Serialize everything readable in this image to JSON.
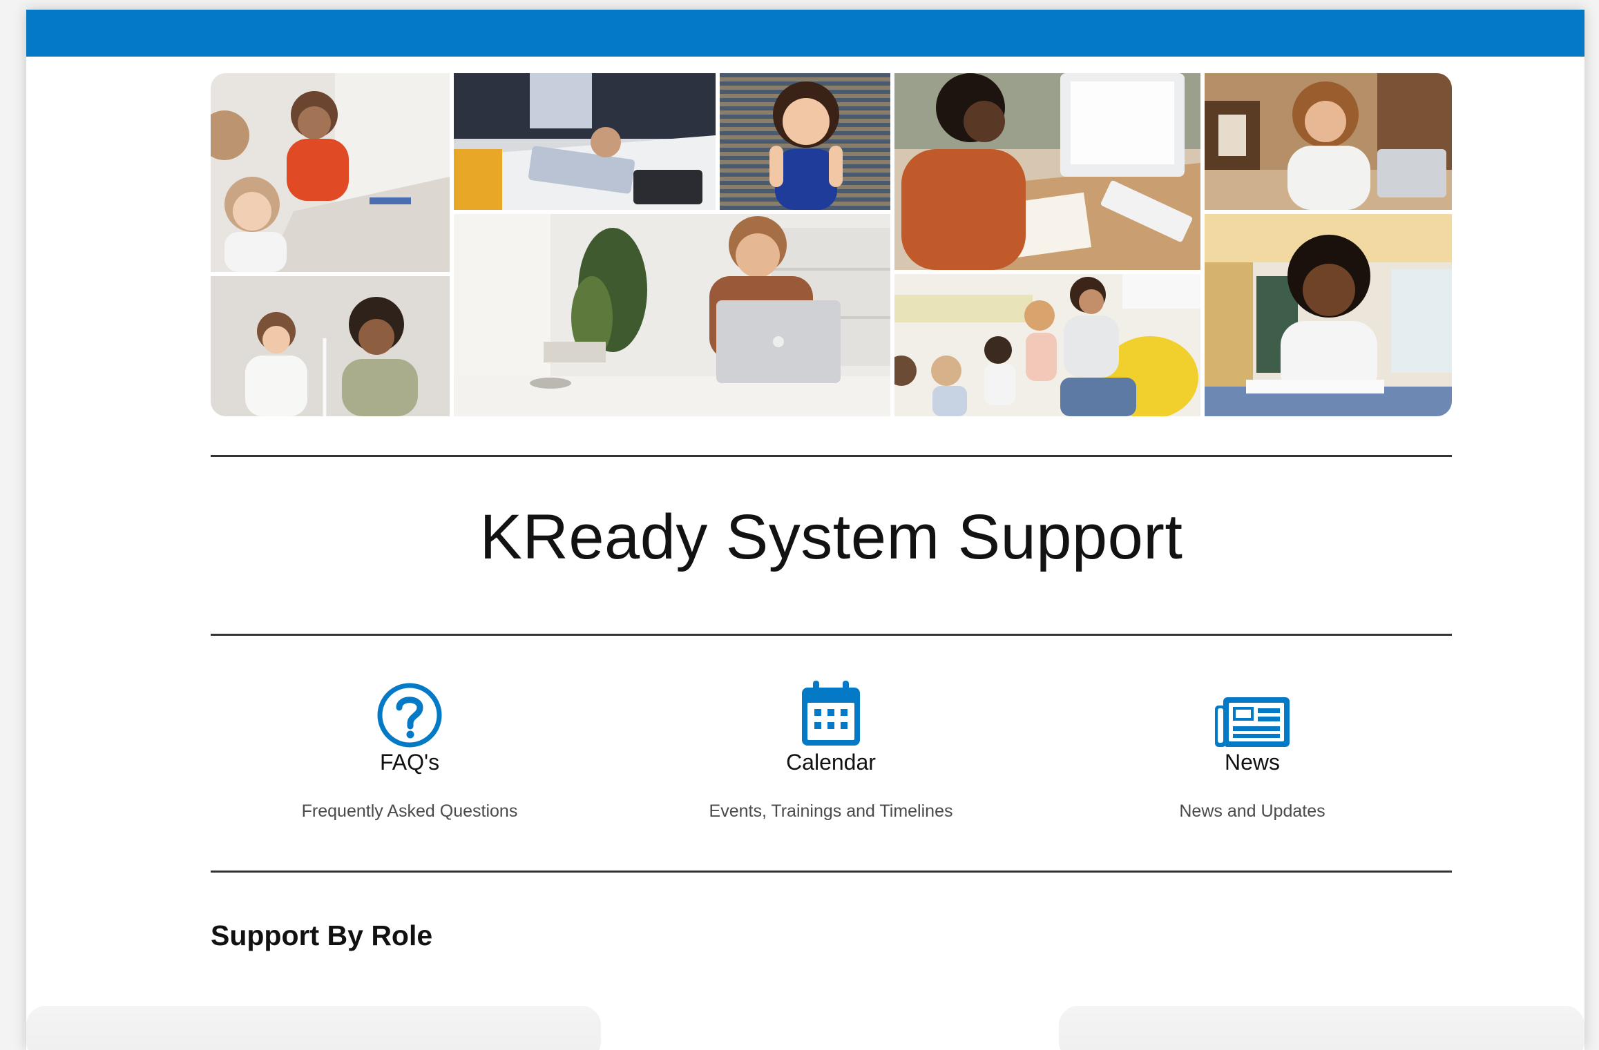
{
  "header": {
    "bar_color": "#0479c5"
  },
  "hero": {
    "images": [
      "children-at-desk-photo",
      "business-analytics-photo",
      "smiling-girl-photo",
      "student-at-computer-photo",
      "woman-on-phone-photo",
      "teacher-with-student-photo",
      "man-with-laptop-photo",
      "teacher-reading-to-children-photo",
      "boy-drawing-photo"
    ]
  },
  "page": {
    "title": "KReady System Support"
  },
  "quick_links": [
    {
      "icon": "question-circle-icon",
      "label": "FAQ's",
      "description": "Frequently Asked Questions"
    },
    {
      "icon": "calendar-icon",
      "label": "Calendar",
      "description": "Events, Trainings and Timelines"
    },
    {
      "icon": "newspaper-icon",
      "label": "News",
      "description": "News and Updates"
    }
  ],
  "roles": {
    "heading": "Support By Role"
  },
  "colors": {
    "accent": "#0479c5",
    "rule": "#333333",
    "text": "#111111"
  }
}
